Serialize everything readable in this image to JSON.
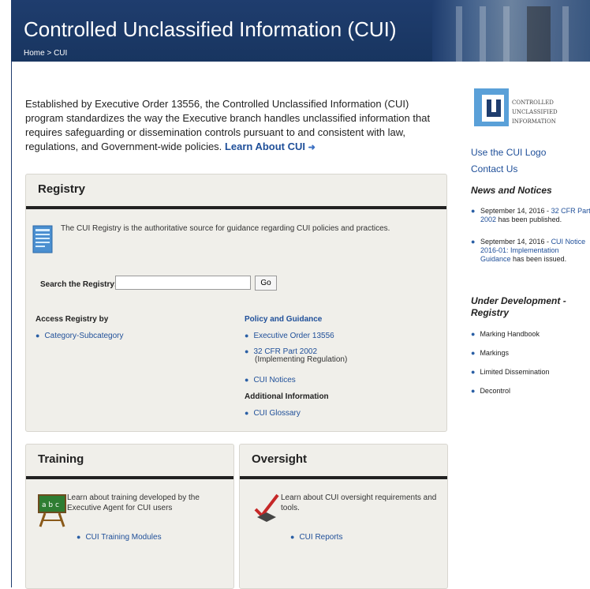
{
  "header": {
    "title": "Controlled Unclassified Information (CUI)",
    "breadcrumb": "Home > CUI"
  },
  "intro": {
    "text": "Established by Executive Order 13556, the Controlled Unclassified Information (CUI) program standardizes the way the Executive branch handles unclassified information that requires safeguarding or dissemination controls pursuant to and consistent with law, regulations, and Government-wide policies.",
    "link": "Learn About CUI"
  },
  "registry": {
    "title": "Registry",
    "description": "The CUI Registry is the authoritative source for guidance regarding CUI policies and practices.",
    "search_label": "Search the Registry:",
    "search_value": "",
    "search_button": "Go",
    "access_heading": "Access Registry by",
    "access_links": [
      "Category-Subcategory"
    ],
    "policy_heading": "Policy and Guidance",
    "policy_links": [
      "Executive Order 13556",
      "32 CFR Part 2002",
      "CUI Notices"
    ],
    "policy_sub": "(Implementing Regulation)",
    "additional_heading": "Additional Information",
    "additional_links": [
      "CUI Glossary"
    ]
  },
  "training": {
    "title": "Training",
    "description": "Learn about training developed by the Executive Agent for CUI users",
    "link": "CUI Training Modules"
  },
  "oversight": {
    "title": "Oversight",
    "description": "Learn about CUI oversight requirements and tools.",
    "link": "CUI Reports"
  },
  "sidebar": {
    "logo_lines": [
      "CONTROLLED",
      "UNCLASSIFIED",
      "INFORMATION"
    ],
    "use_logo": "Use the CUI Logo",
    "contact": "Contact Us",
    "news_heading": "News and Notices",
    "news": [
      {
        "date": "September 14, 2016 - ",
        "link": "32 CFR Part 2002",
        "rest": " has been published."
      },
      {
        "date": "September 14, 2016 - ",
        "link": "CUI Notice 2016-01: Implementation Guidance",
        "rest": " has been issued."
      }
    ],
    "dev_heading": "Under Development - Registry",
    "dev_items": [
      "Marking Handbook",
      "Markings",
      "Limited Dissemination",
      "Decontrol"
    ]
  },
  "colors": {
    "header_bg": "#1f3d6e",
    "link": "#1f4f99",
    "panel_bg": "#f0efea"
  }
}
